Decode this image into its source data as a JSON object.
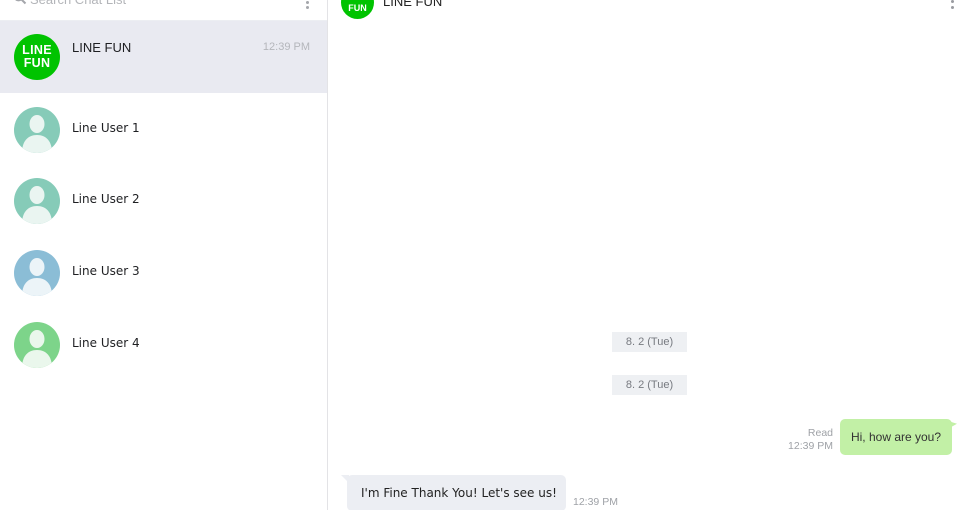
{
  "search": {
    "placeholder": "Search Chat List"
  },
  "chats": [
    {
      "name": "LINE FUN",
      "time": "12:39 PM",
      "logo_line1": "LINE",
      "logo_line2": "FUN",
      "active": true
    },
    {
      "name": "Line User 1",
      "avatar_color": "#86cbb8"
    },
    {
      "name": "Line User 2",
      "avatar_color": "#86cbb8"
    },
    {
      "name": "Line User 3",
      "avatar_color": "#8bbdd6"
    },
    {
      "name": "Line User 4",
      "avatar_color": "#7dd48a"
    }
  ],
  "conversation": {
    "title": "LINE FUN",
    "header_logo_text": "FUN",
    "date_separators": [
      "8. 2 (Tue)",
      "8. 2 (Tue)"
    ],
    "sent_message": {
      "text": "Hi, how are you?",
      "status": "Read",
      "time": "12:39 PM"
    },
    "received_message": {
      "text": "I'm Fine Thank You! Let's see us!",
      "time": "12:39 PM"
    }
  },
  "colors": {
    "brand": "#00c300",
    "sent_bubble": "#c2f0a6",
    "received_bubble": "#eceef3",
    "active_row": "#e9eaf1"
  },
  "icons": {
    "search": "search-icon",
    "more": "kebab-menu-icon",
    "avatar": "user-silhouette-icon"
  }
}
